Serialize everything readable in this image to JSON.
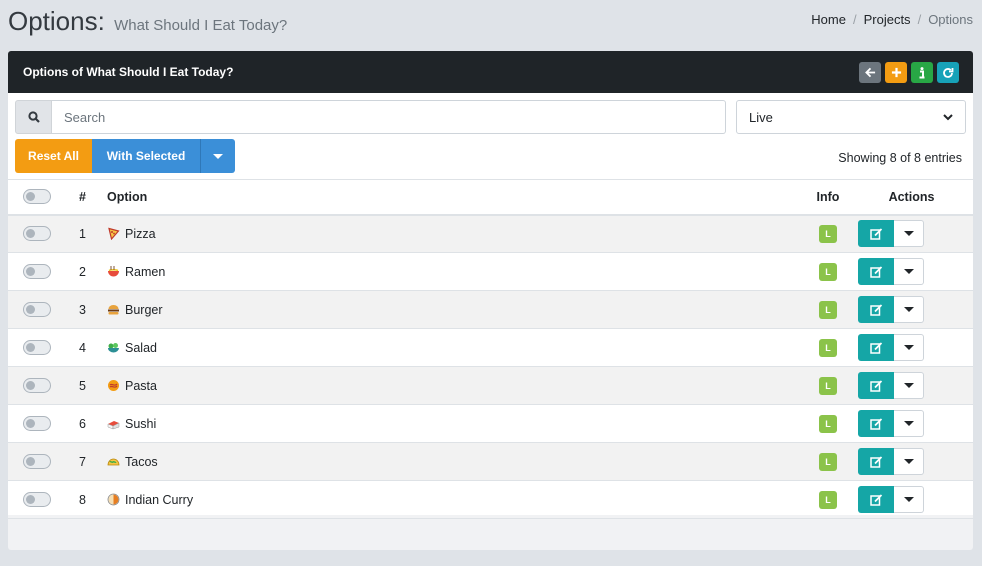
{
  "header": {
    "title": "Options:",
    "subtitle": "What Should I Eat Today?",
    "breadcrumb": [
      "Home",
      "Projects",
      "Options"
    ]
  },
  "card": {
    "title": "Options of What Should I Eat Today?",
    "tools": [
      {
        "icon": "arrow-left-icon",
        "color": "#6c757d"
      },
      {
        "icon": "plus-icon",
        "color": "#f39c12"
      },
      {
        "icon": "info-icon",
        "color": "#28a745"
      },
      {
        "icon": "refresh-icon",
        "color": "#17a2b8"
      }
    ]
  },
  "search": {
    "placeholder": "Search",
    "value": ""
  },
  "status_filter": {
    "selected": "Live"
  },
  "buttons": {
    "reset": "Reset All",
    "with_selected": "With Selected"
  },
  "showing": "Showing 8 of 8 entries",
  "table": {
    "headers": {
      "num": "#",
      "option": "Option",
      "info": "Info",
      "actions": "Actions"
    },
    "rows": [
      {
        "num": "1",
        "option": "Pizza",
        "icon": "pizza-icon",
        "badge": "L"
      },
      {
        "num": "2",
        "option": "Ramen",
        "icon": "ramen-icon",
        "badge": "L"
      },
      {
        "num": "3",
        "option": "Burger",
        "icon": "burger-icon",
        "badge": "L"
      },
      {
        "num": "4",
        "option": "Salad",
        "icon": "salad-icon",
        "badge": "L"
      },
      {
        "num": "5",
        "option": "Pasta",
        "icon": "pasta-icon",
        "badge": "L"
      },
      {
        "num": "6",
        "option": "Sushi",
        "icon": "sushi-icon",
        "badge": "L"
      },
      {
        "num": "7",
        "option": "Tacos",
        "icon": "tacos-icon",
        "badge": "L"
      },
      {
        "num": "8",
        "option": "Indian Curry",
        "icon": "curry-icon",
        "badge": "L"
      }
    ]
  },
  "colors": {
    "accent_teal": "#15a6a6",
    "badge_green": "#8bc34a",
    "reset_orange": "#f39c12",
    "primary_blue": "#3b8fd8"
  }
}
